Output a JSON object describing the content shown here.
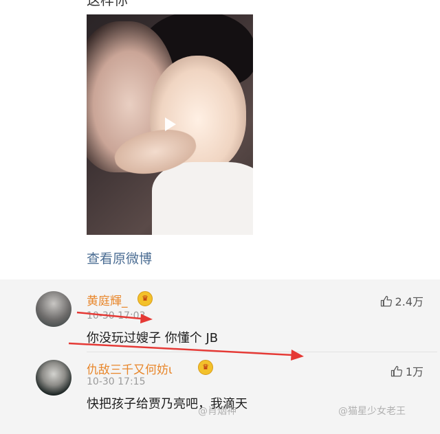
{
  "post": {
    "top_text": "这样你",
    "view_original": "查看原微博"
  },
  "comments": [
    {
      "name": "黄庭輝_",
      "time": "10-30 17:03",
      "text": "你没玩过嫂子 你懂个 JB",
      "likes": "2.4万",
      "badge": "crown-icon"
    },
    {
      "name": "仇敌三千又何妨ι",
      "time": "10-30 17:15",
      "text": "快把孩子给贾乃亮吧，我滴天",
      "likes": "1万",
      "badge": "crown-icon"
    }
  ],
  "watermarks": {
    "left": "@肖烟神",
    "right": "@猫星少女老王"
  },
  "colors": {
    "username": "#e8862a",
    "link": "#4b6d93",
    "annotation_arrow": "#e53935"
  }
}
